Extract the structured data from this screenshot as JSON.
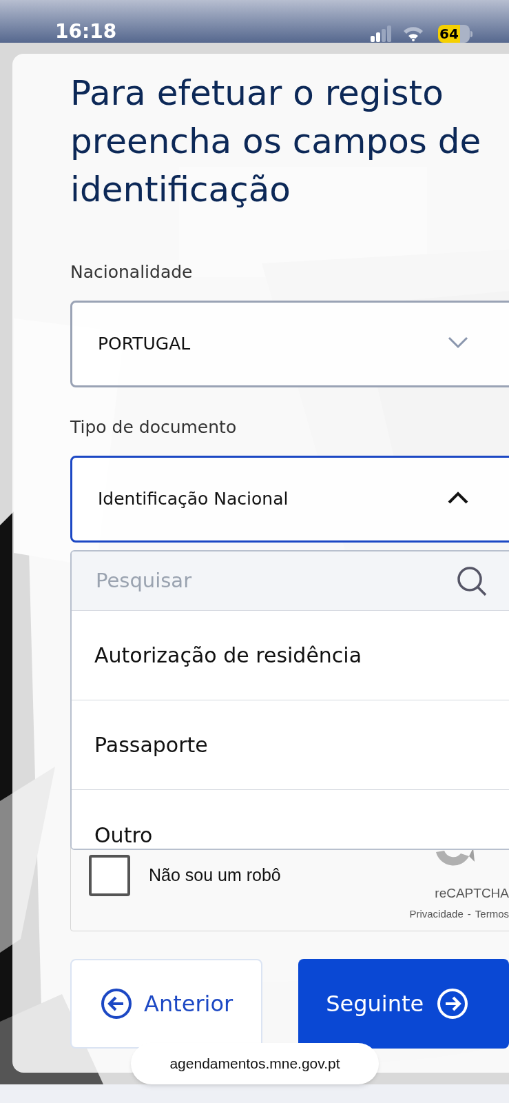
{
  "status_bar": {
    "time": "16:18",
    "battery": "64"
  },
  "heading": "Para efetuar o registo preencha os campos de identificação",
  "fields": [
    {
      "label": "Nacionalidade",
      "value": "PORTUGAL",
      "expanded": false
    },
    {
      "label": "Tipo de documento",
      "value": "Identificação Nacional",
      "expanded": true
    }
  ],
  "dropdown": {
    "search": {
      "placeholder": "Pesquisar"
    },
    "options": [
      {
        "label": "Autorização de residência",
        "selected": false
      },
      {
        "label": "Passaporte",
        "selected": false
      },
      {
        "label": "Outro",
        "selected": false
      }
    ]
  },
  "captcha": {
    "label": "Não sou um robô",
    "checked": false,
    "brand": "reCAPTCHA",
    "links": [
      "Privacidade",
      "Termos"
    ],
    "separator": "-"
  },
  "buttons": [
    {
      "label": "Anterior",
      "kind": "secondary"
    },
    {
      "label": "Seguinte",
      "kind": "primary"
    }
  ],
  "url": "agendamentos.mne.gov.pt"
}
